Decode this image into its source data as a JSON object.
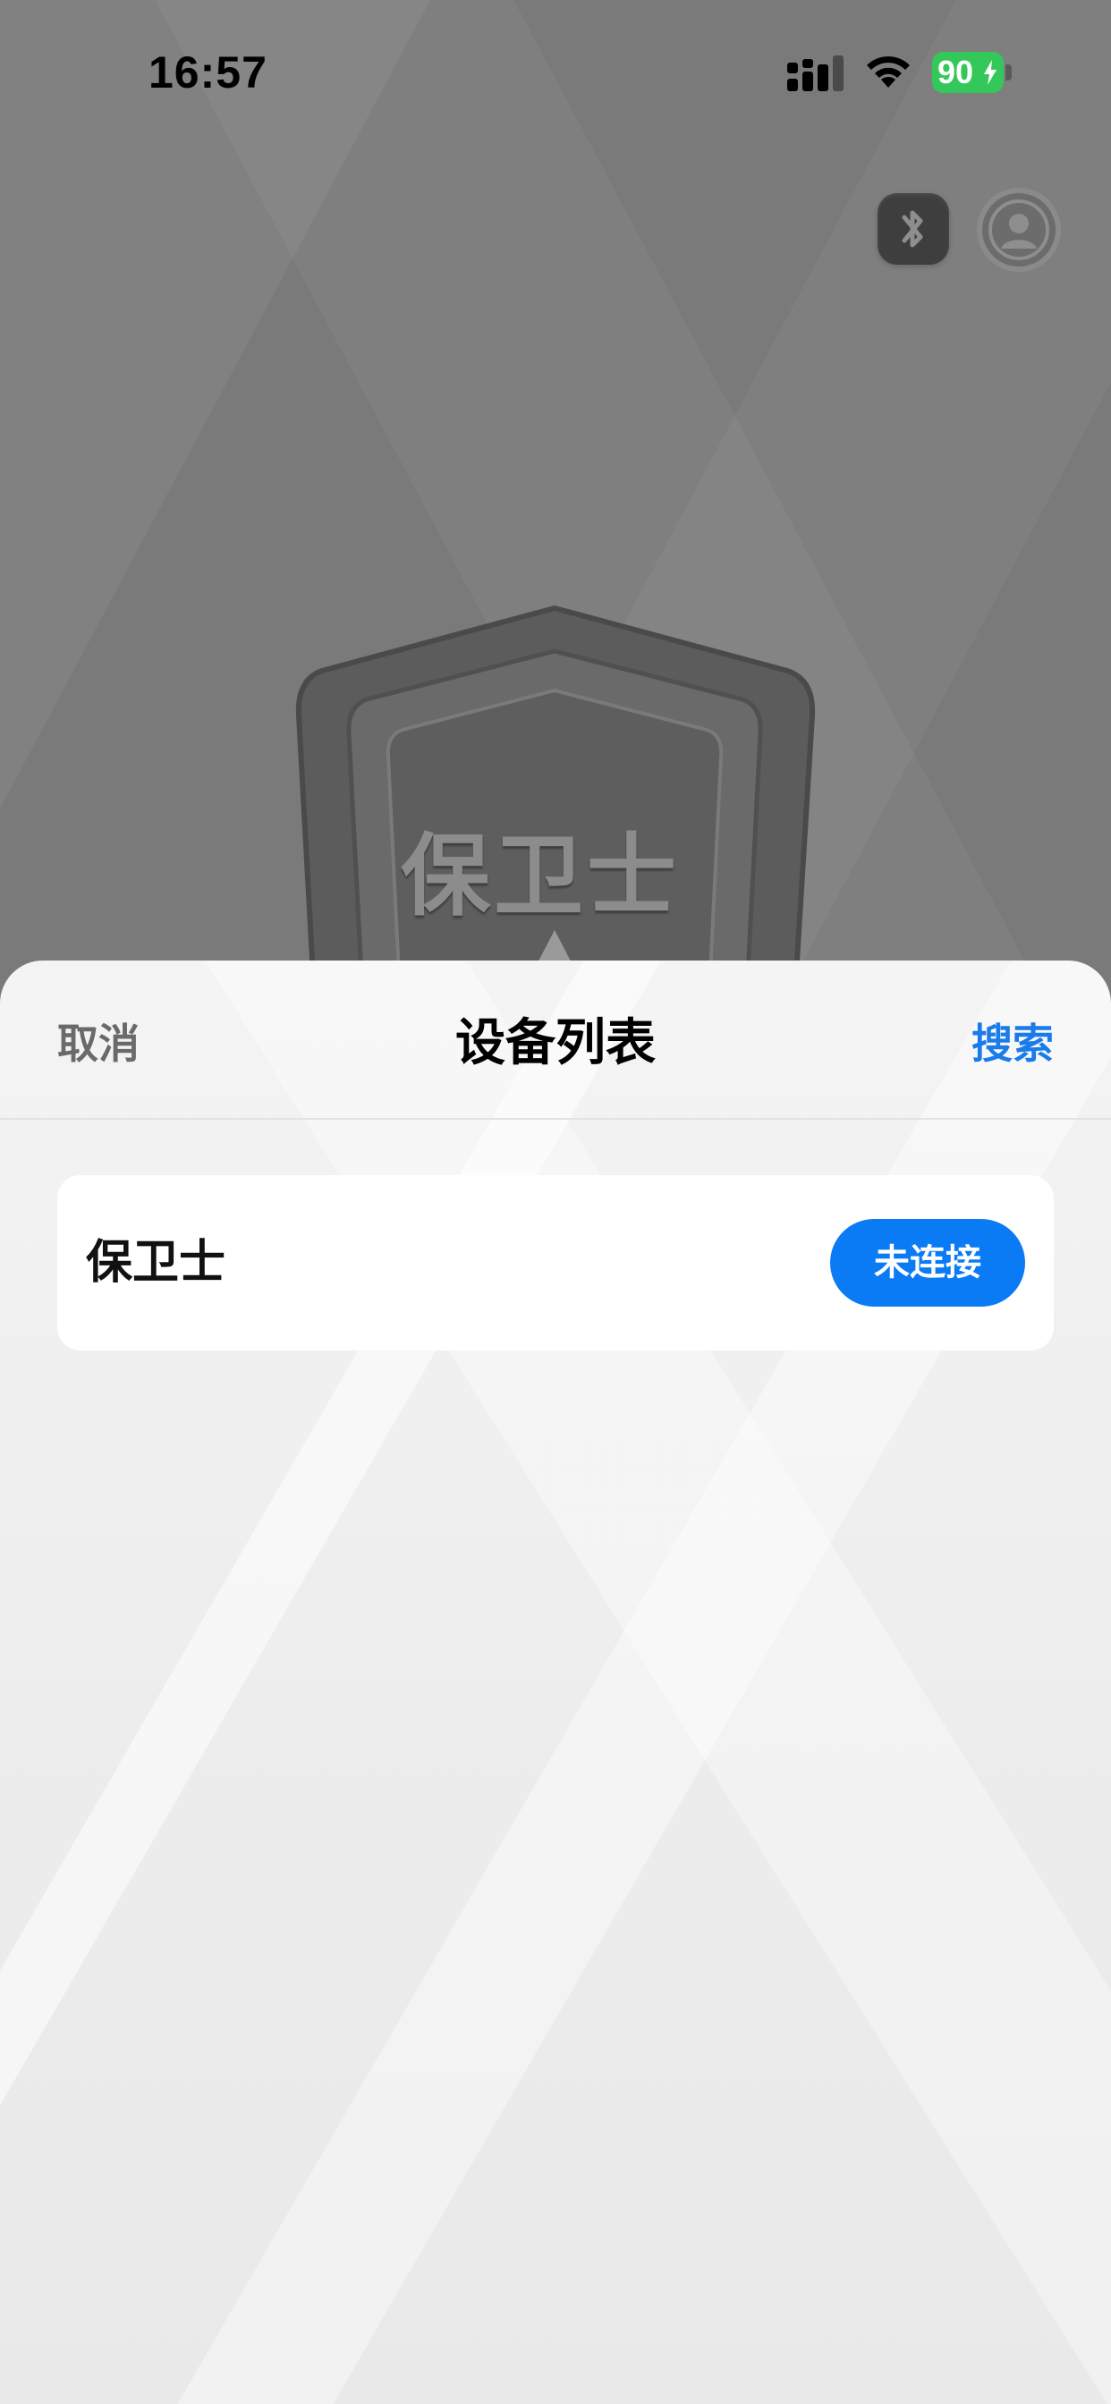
{
  "status_bar": {
    "time": "16:57",
    "battery_level": "90",
    "signal_icon": "cellular-signal-icon",
    "wifi_icon": "wifi-icon",
    "battery_icon": "battery-charging-icon",
    "battery_color": "#34c759"
  },
  "background": {
    "logo_text": "保卫士",
    "bluetooth_icon": "bluetooth-icon",
    "profile_icon": "user-avatar-icon"
  },
  "sheet": {
    "cancel_label": "取消",
    "title": "设备列表",
    "search_label": "搜索",
    "accent_color": "#0a7bf5"
  },
  "devices": [
    {
      "name": "保卫士",
      "status_label": "未连接"
    }
  ]
}
